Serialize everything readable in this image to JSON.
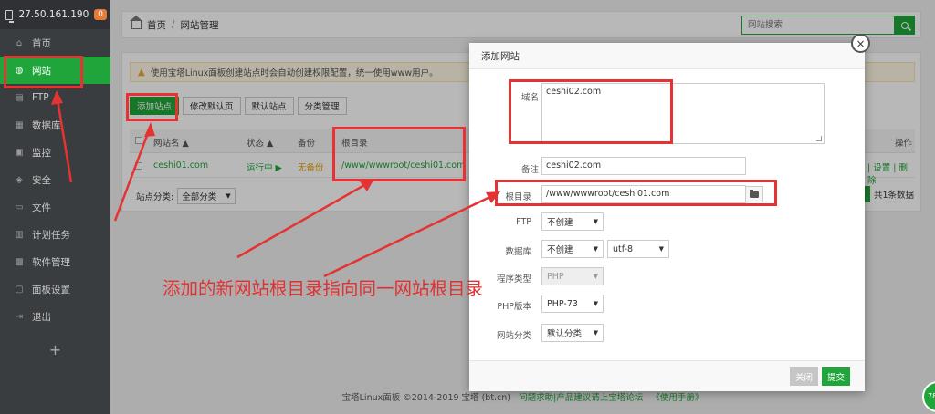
{
  "sidebar": {
    "ip": "27.50.161.190",
    "badge": "0",
    "items": [
      {
        "label": "首页",
        "icon": "home-icon"
      },
      {
        "label": "网站",
        "icon": "globe-icon"
      },
      {
        "label": "FTP",
        "icon": "ftp-icon"
      },
      {
        "label": "数据库",
        "icon": "database-icon"
      },
      {
        "label": "监控",
        "icon": "monitor-icon"
      },
      {
        "label": "安全",
        "icon": "shield-icon"
      },
      {
        "label": "文件",
        "icon": "file-icon"
      },
      {
        "label": "计划任务",
        "icon": "calendar-icon"
      },
      {
        "label": "软件管理",
        "icon": "software-icon"
      },
      {
        "label": "面板设置",
        "icon": "settings-icon"
      },
      {
        "label": "退出",
        "icon": "logout-icon"
      }
    ],
    "plus": "+"
  },
  "breadcrumb": {
    "home": "首页",
    "sep": "/",
    "current": "网站管理"
  },
  "search": {
    "placeholder": "网站搜索"
  },
  "notice": {
    "text": "使用宝塔Linux面板创建站点时会自动创建权限配置，统一使用www用户。"
  },
  "toolbar": {
    "add_site": "添加站点",
    "modify_default": "修改默认页",
    "default_site": "默认站点",
    "category_manage": "分类管理"
  },
  "table": {
    "headers": {
      "name": "网站名 ▲",
      "status": "状态 ▲",
      "backup": "备份",
      "root": "根目录",
      "actions": "操作"
    },
    "row": {
      "name": "ceshi01.com",
      "status": "运行中 ▶",
      "backup": "无备份",
      "root": "/www/wwwroot/ceshi01.com",
      "actions": "| 设置 | 删除"
    }
  },
  "filter": {
    "label": "站点分类:",
    "value": "全部分类"
  },
  "pager": {
    "total": "共1条数据"
  },
  "footer": {
    "copyright": "宝塔Linux面板 ©2014-2019 宝塔 (bt.cn)",
    "help": "问题求助|产品建议请上宝塔论坛",
    "manual": "《使用手册》"
  },
  "modal": {
    "title": "添加网站",
    "close": "×",
    "domain_label": "域名",
    "domain_value": "ceshi02.com",
    "remark_label": "备注",
    "remark_value": "ceshi02.com",
    "root_label": "根目录",
    "root_value": "/www/wwwroot/ceshi01.com",
    "ftp_label": "FTP",
    "ftp_value": "不创建",
    "db_label": "数据库",
    "db_value": "不创建",
    "charset_value": "utf-8",
    "type_label": "程序类型",
    "type_value": "PHP",
    "php_label": "PHP版本",
    "php_value": "PHP-73",
    "category_label": "网站分类",
    "category_value": "默认分类",
    "cancel": "关闭",
    "submit": "提交"
  },
  "annotation": {
    "text": "添加的新网站根目录指向同一网站根目录",
    "color": "#e03030"
  },
  "corner_badge": "78",
  "colors": {
    "accent": "#20a53a",
    "sidebar": "#3a3d40",
    "annotation": "#e53333"
  }
}
